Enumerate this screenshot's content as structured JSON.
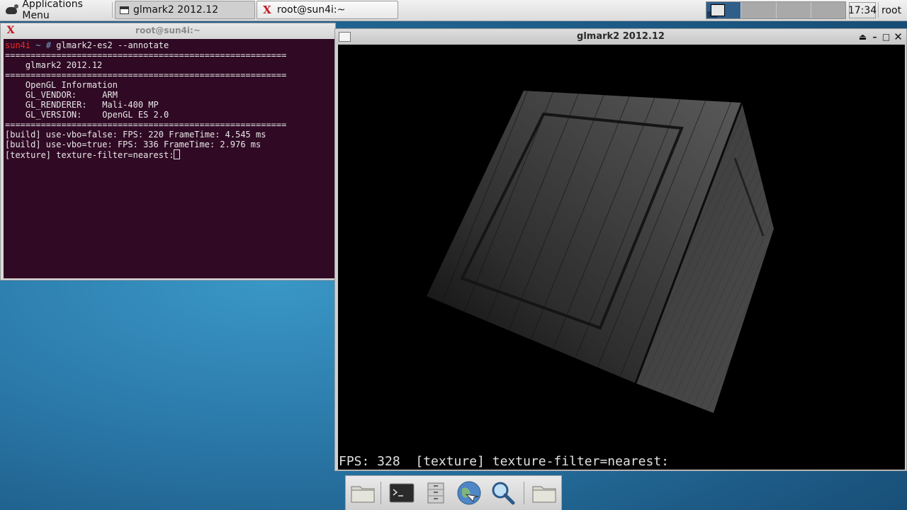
{
  "panel": {
    "apps_menu_label": "Applications Menu",
    "tasks": [
      {
        "label": "glmark2 2012.12"
      },
      {
        "label": "root@sun4i:~"
      }
    ],
    "clock": "17:34",
    "user": "root"
  },
  "terminal": {
    "title": "root@sun4i:~",
    "prompt_host": "sun4i",
    "prompt_dir": "~",
    "prompt_symbol": "#",
    "command": "glmark2-es2 --annotate",
    "lines": [
      "=======================================================",
      "    glmark2 2012.12",
      "=======================================================",
      "    OpenGL Information",
      "    GL_VENDOR:     ARM",
      "    GL_RENDERER:   Mali-400 MP",
      "    GL_VERSION:    OpenGL ES 2.0",
      "=======================================================",
      "[build] use-vbo=false: FPS: 220 FrameTime: 4.545 ms",
      "[build] use-vbo=true: FPS: 336 FrameTime: 2.976 ms"
    ],
    "last_line": "[texture] texture-filter=nearest:"
  },
  "glmark": {
    "title": "glmark2 2012.12",
    "overlay": "FPS: 328  [texture] texture-filter=nearest:"
  },
  "dock": {
    "items": [
      "folder-icon",
      "terminal-icon",
      "file-cabinet-icon",
      "web-browser-icon",
      "search-icon",
      "folder-icon"
    ]
  },
  "colors": {
    "terminal_bg": "#300a24",
    "prompt_host": "#ef2929",
    "prompt_dir": "#729fcf"
  }
}
